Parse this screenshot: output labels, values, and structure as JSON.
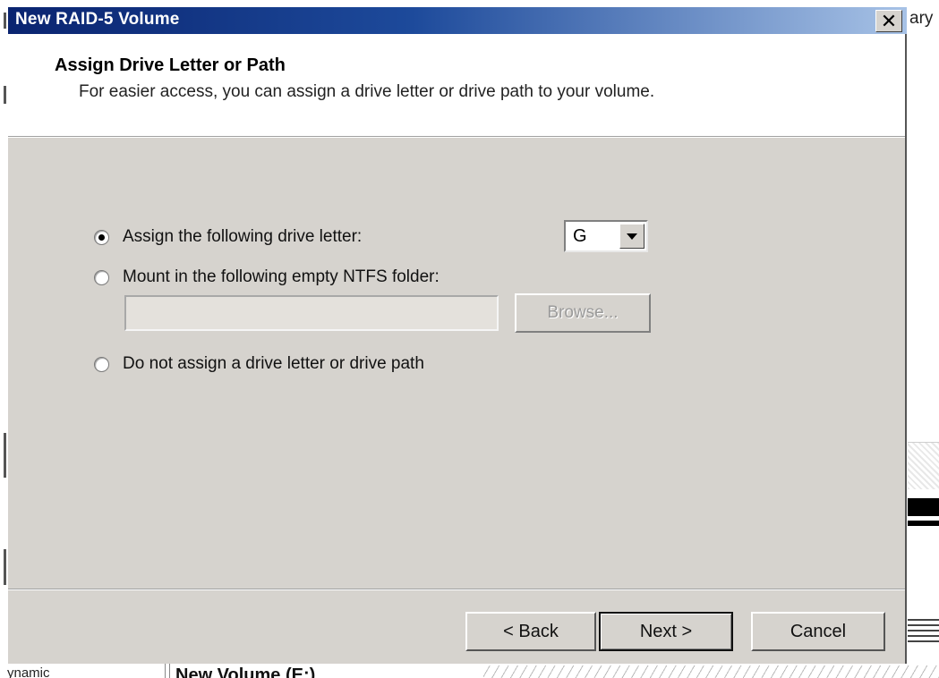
{
  "window": {
    "title": "New RAID-5 Volume",
    "close_glyph": "✕"
  },
  "header": {
    "title": "Assign Drive Letter or Path",
    "subtitle": "For easier access, you can assign a drive letter or drive path to your volume."
  },
  "options": {
    "assign_letter_label": "Assign the following drive letter:",
    "mount_folder_label": "Mount in the following empty NTFS folder:",
    "no_assign_label": "Do not assign a drive letter or drive path",
    "selected": "assign_letter"
  },
  "drive_letter": {
    "value": "G"
  },
  "folder": {
    "value": "",
    "browse_label": "Browse..."
  },
  "buttons": {
    "back_label": "< Back",
    "next_label": "Next >",
    "cancel_label": "Cancel"
  },
  "background": {
    "right_text": "ary",
    "bottom_text1": "ynamic",
    "bottom_text2": "New Volume (E:)"
  },
  "icons": {
    "close": "close-icon",
    "dropdown": "chevron-down-icon",
    "radio_checked": "radio-checked-icon",
    "radio_unchecked": "radio-unchecked-icon"
  },
  "colors": {
    "titlebar_start": "#0a2470",
    "titlebar_end": "#a7c2e6",
    "dialog_face": "#d6d3ce",
    "header_bg": "#ffffff"
  }
}
